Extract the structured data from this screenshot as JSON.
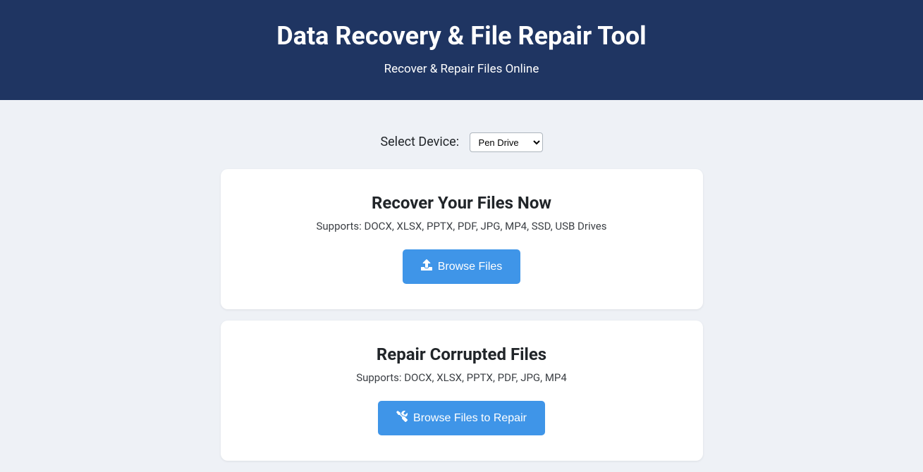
{
  "header": {
    "title": "Data Recovery & File Repair Tool",
    "subtitle": "Recover & Repair Files Online"
  },
  "device": {
    "label": "Select Device:",
    "selected": "Pen Drive"
  },
  "recover": {
    "heading": "Recover Your Files Now",
    "supports": "Supports: DOCX, XLSX, PPTX, PDF, JPG, MP4, SSD, USB Drives",
    "button": "Browse Files"
  },
  "repair": {
    "heading": "Repair Corrupted Files",
    "supports": "Supports: DOCX, XLSX, PPTX, PDF, JPG, MP4",
    "button": "Browse Files to Repair"
  }
}
